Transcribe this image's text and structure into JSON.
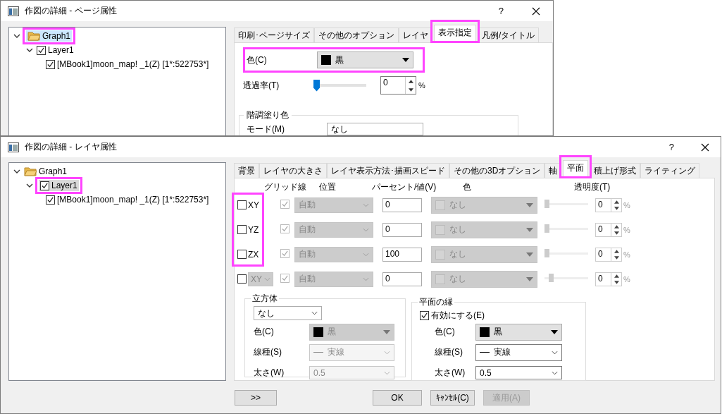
{
  "page_dialog": {
    "title": "作図の詳細 - ページ属性",
    "help": "?",
    "tree": [
      {
        "label": "Graph1",
        "selected": true,
        "highlighted": true,
        "expanded": true,
        "children": [
          {
            "label": "Layer1",
            "checked": true,
            "selected": false,
            "highlighted": false,
            "expanded": true,
            "children": [
              {
                "label": "[MBook1]moon_map! _1(Z) [1*:522753*]",
                "checked": true,
                "selected": false
              }
            ]
          }
        ]
      }
    ],
    "tabs": [
      {
        "label": "印刷･ページサイズ",
        "selected": false,
        "highlighted": false
      },
      {
        "label": "その他のオプション",
        "selected": false,
        "highlighted": false
      },
      {
        "label": "レイヤ",
        "selected": false,
        "highlighted": false
      },
      {
        "label": "表示指定",
        "selected": true,
        "highlighted": true
      },
      {
        "label": "凡例/タイトル",
        "selected": false,
        "highlighted": false
      }
    ],
    "color": {
      "label": "色(C)",
      "value": "黒",
      "highlighted": true
    },
    "transparency": {
      "label": "透過率(T)",
      "level": 0,
      "value": "0",
      "unit": "%"
    },
    "fill_group": {
      "title": "階調塗り色",
      "mode_label": "モード(M)",
      "mode_value": "なし"
    }
  },
  "layer_dialog": {
    "title": "作図の詳細 - レイヤ属性",
    "help": "?",
    "tree": [
      {
        "label": "Graph1",
        "selected": false,
        "highlighted": false,
        "expanded": true,
        "children": [
          {
            "label": "Layer1",
            "checked": true,
            "selected": true,
            "highlighted": true,
            "expanded": true,
            "children": [
              {
                "label": "[MBook1]moon_map! _1(Z) [1*:522753*]",
                "checked": true,
                "selected": false
              }
            ]
          }
        ]
      }
    ],
    "tabs": [
      {
        "label": "背景",
        "selected": false,
        "highlighted": false
      },
      {
        "label": "レイヤの大きさ",
        "selected": false,
        "highlighted": false
      },
      {
        "label": "レイヤ表示方法･描画スピード",
        "selected": false,
        "highlighted": false
      },
      {
        "label": "その他の3Dオプション",
        "selected": false,
        "highlighted": false
      },
      {
        "label": "軸",
        "selected": false,
        "highlighted": false
      },
      {
        "label": "平面",
        "selected": true,
        "highlighted": true
      },
      {
        "label": "積上げ形式",
        "selected": false,
        "highlighted": false
      },
      {
        "label": "ライティング",
        "selected": false,
        "highlighted": false
      }
    ],
    "columns": [
      "グリッド線",
      "位置",
      "パーセント/値(V)",
      "色",
      "透明度(T)"
    ],
    "planes_highlighted": true,
    "planes": [
      {
        "kind": "label",
        "plane": "XY",
        "checked": false,
        "grid_checked": true,
        "position": "自動",
        "value": "0",
        "color_value": "なし",
        "level": 0,
        "opacity": "0",
        "unit": "%"
      },
      {
        "kind": "label",
        "plane": "YZ",
        "checked": false,
        "grid_checked": true,
        "position": "自動",
        "value": "0",
        "color_value": "なし",
        "level": 0,
        "opacity": "0",
        "unit": "%"
      },
      {
        "kind": "label",
        "plane": "ZX",
        "checked": false,
        "grid_checked": true,
        "position": "自動",
        "value": "100",
        "color_value": "なし",
        "level": 0,
        "opacity": "0",
        "unit": "%"
      },
      {
        "kind": "combo",
        "plane": "XY",
        "checked": false,
        "grid_checked": true,
        "position": "自動",
        "value": "0",
        "color_value": "なし",
        "level": 0.1,
        "opacity": "0",
        "unit": "%"
      }
    ],
    "cube": {
      "title": "立方体",
      "type": "なし",
      "disabled": true,
      "color_label": "色(C)",
      "color_value": "黒",
      "line_label": "線種(S)",
      "line_value": "実線",
      "width_label": "太さ(W)",
      "width_value": "0.5"
    },
    "edge": {
      "title": "平面の縁",
      "enable_label": "有効にする(E)",
      "checked": true,
      "color_label": "色(C)",
      "color_value": "黒",
      "line_label": "線種(S)",
      "line_value": "実線",
      "width_label": "太さ(W)",
      "width_value": "0.5"
    },
    "buttons": [
      {
        "label": ">>",
        "disabled": false
      },
      {
        "label": "ｷｬﾝｾﾙ(C)",
        "disabled": false
      },
      {
        "label": "適用(A)",
        "disabled": true
      }
    ],
    "ok_button": {
      "label": "OK",
      "disabled": false
    }
  }
}
